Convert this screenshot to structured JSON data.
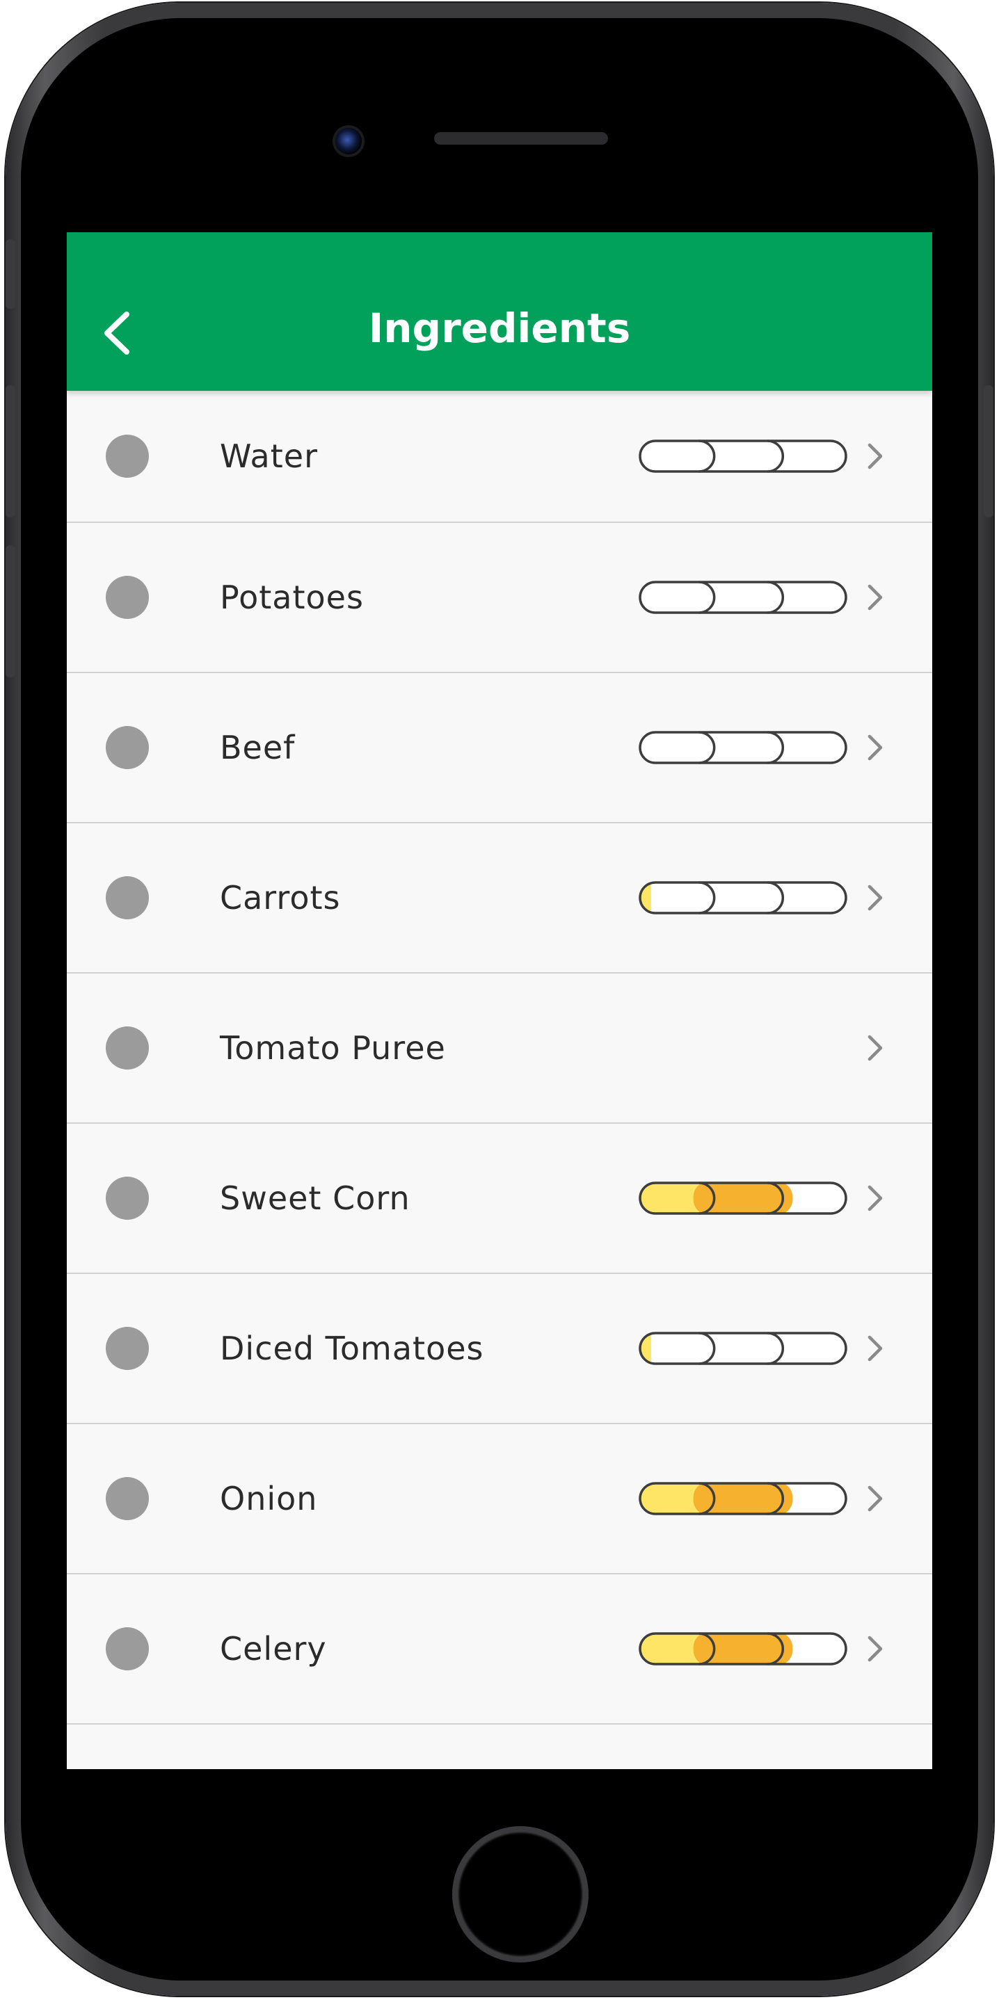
{
  "header": {
    "title": "Ingredients",
    "back_icon": "chevron-left-icon"
  },
  "colors": {
    "brand": "#02a15b",
    "level_light": "#ffe566",
    "level_mid": "#f6b22f",
    "dot": "#9b9b9b"
  },
  "ingredients": [
    {
      "name": "Water",
      "level": 0,
      "show_meter": true
    },
    {
      "name": "Potatoes",
      "level": 0,
      "show_meter": true
    },
    {
      "name": "Beef",
      "level": 0,
      "show_meter": true
    },
    {
      "name": "Carrots",
      "level": 0.1,
      "show_meter": true
    },
    {
      "name": "Tomato Puree",
      "level": 0,
      "show_meter": false
    },
    {
      "name": "Sweet Corn",
      "level": 2,
      "show_meter": true
    },
    {
      "name": "Diced Tomatoes",
      "level": 0.1,
      "show_meter": true
    },
    {
      "name": "Onion",
      "level": 2,
      "show_meter": true
    },
    {
      "name": "Celery",
      "level": 2,
      "show_meter": true
    }
  ]
}
